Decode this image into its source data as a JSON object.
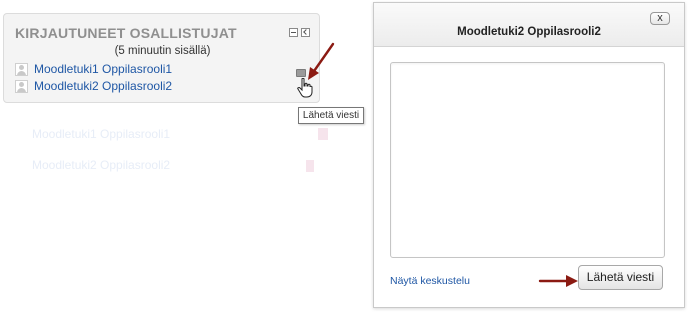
{
  "block": {
    "title": "KIRJAUTUNEET OSALLISTUJAT",
    "subtitle": "(5 minuutin sisällä)",
    "users": [
      {
        "name": "Moodletuki1 Oppilasrooli1"
      },
      {
        "name": "Moodletuki2 Oppilasrooli2"
      }
    ],
    "tooltip": "Lähetä viesti"
  },
  "ghost_users": [
    "Moodletuki1 Oppilasrooli1",
    "Moodletuki2 Oppilasrooli2"
  ],
  "dialog": {
    "title": "Moodletuki2 Oppilasrooli2",
    "close_label": "x",
    "message_value": "",
    "show_conversation": "Näytä keskustelu",
    "send_label": "Lähetä viesti"
  },
  "colors": {
    "link": "#1f57a5",
    "arrow": "#8b1a12",
    "block_bg": "#f4f4f4"
  }
}
